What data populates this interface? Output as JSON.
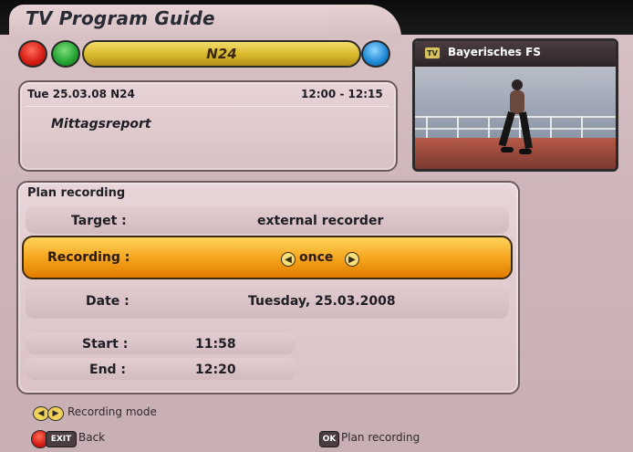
{
  "header": {
    "title": "TV Program Guide",
    "channel": "N24"
  },
  "program_info": {
    "date_channel": "Tue 25.03.08 N24",
    "time_range": "12:00 - 12:15",
    "program": "Mittagsreport"
  },
  "preview": {
    "channel": "Bayerisches FS",
    "tv_icon_text": "TV"
  },
  "plan_recording": {
    "title": "Plan recording",
    "target_label": "Target :",
    "target_value": "external recorder",
    "recording_label": "Recording :",
    "recording_value": "once",
    "date_label": "Date :",
    "date_value": "Tuesday, 25.03.2008",
    "start_label": "Start :",
    "start_value": "11:58",
    "end_label": "End :",
    "end_value": "12:20"
  },
  "legend": {
    "recording_mode": "Recording mode",
    "back": "Back",
    "plan_recording": "Plan recording",
    "exit_text": "EXIT",
    "ok_text": "OK"
  },
  "colors": {
    "accent_orange": "#f5a31b",
    "channel_yellow": "#d7b72a",
    "panel_pink": "#d9c3c6"
  }
}
